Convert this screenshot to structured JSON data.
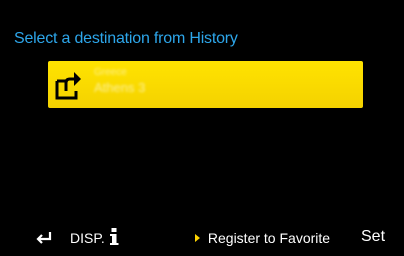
{
  "header": {
    "title": "Select a destination from History"
  },
  "history": {
    "items": [
      {
        "line1": "Greece",
        "line2": "Athens 3",
        "selected": true,
        "icon": "export-arrow-icon"
      }
    ]
  },
  "footer": {
    "back_icon": "return-arrow-icon",
    "disp_label": "DISP.",
    "info_icon": "info-icon",
    "register_label": "Register to Favorite",
    "set_label": "Set"
  },
  "colors": {
    "background": "#000000",
    "header_text": "#2da6ea",
    "selection": "#ffe300",
    "accent_arrow": "#ffd400",
    "text": "#ffffff"
  }
}
